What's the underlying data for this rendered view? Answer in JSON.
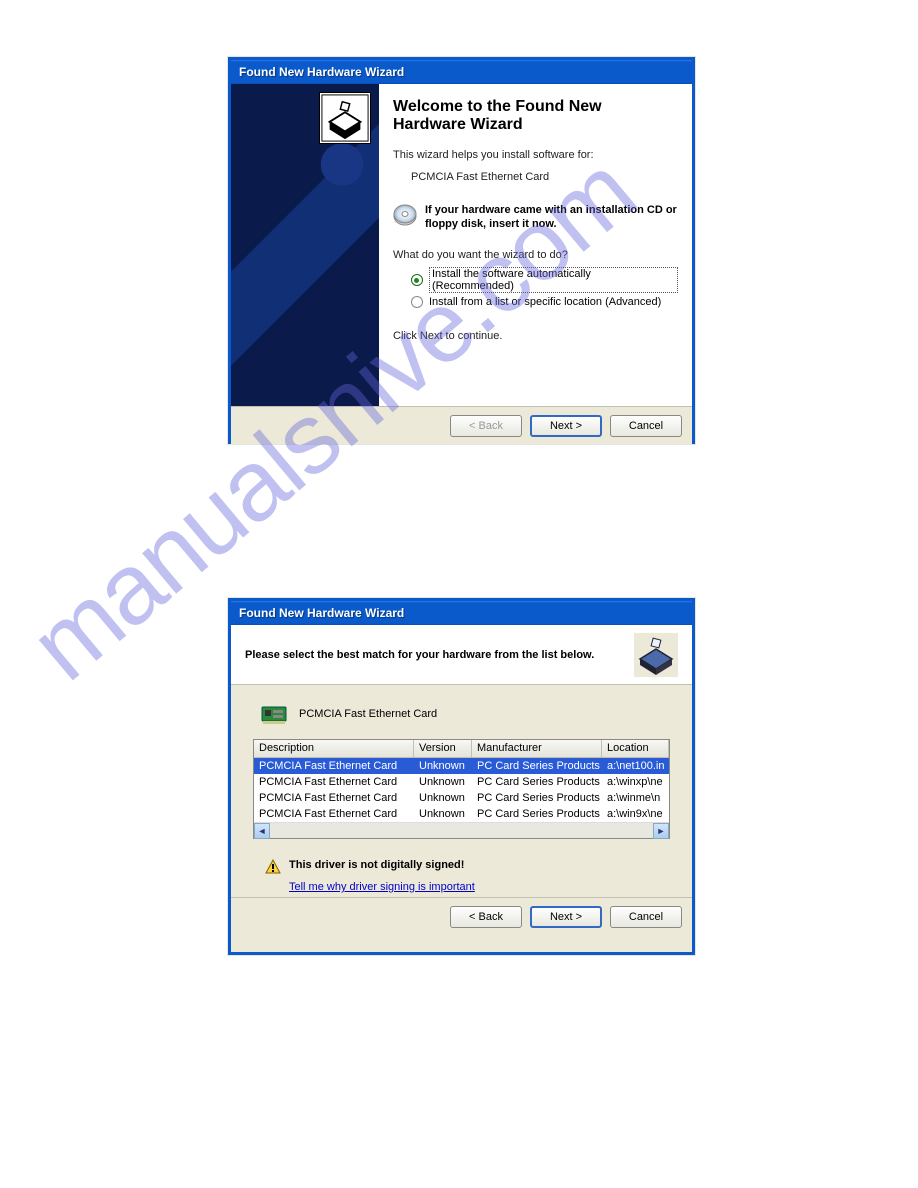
{
  "watermark": "manualsnive.com",
  "dialog1": {
    "title": "Found New Hardware Wizard",
    "heading": "Welcome to the Found New Hardware Wizard",
    "intro": "This wizard helps you install software for:",
    "device": "PCMCIA Fast Ethernet Card",
    "cd_prompt": "If your hardware came with an installation CD or floppy disk, insert it now.",
    "question": "What do you want the wizard to do?",
    "radio_auto": "Install the software automatically (Recommended)",
    "radio_list": "Install from a list or specific location (Advanced)",
    "continue": "Click Next to continue.",
    "buttons": {
      "back": "< Back",
      "next": "Next >",
      "cancel": "Cancel"
    }
  },
  "dialog2": {
    "title": "Found New Hardware Wizard",
    "header": "Please select the best match for your hardware from the list below.",
    "device": "PCMCIA Fast Ethernet Card",
    "columns": {
      "desc": "Description",
      "ver": "Version",
      "man": "Manufacturer",
      "loc": "Location"
    },
    "rows": [
      {
        "desc": "PCMCIA Fast Ethernet Card",
        "ver": "Unknown",
        "man": "PC Card Series Products",
        "loc": "a:\\net100.in"
      },
      {
        "desc": "PCMCIA Fast Ethernet Card",
        "ver": "Unknown",
        "man": "PC Card Series Products",
        "loc": "a:\\winxp\\ne"
      },
      {
        "desc": "PCMCIA Fast Ethernet Card",
        "ver": "Unknown",
        "man": "PC Card Series Products",
        "loc": "a:\\winme\\n"
      },
      {
        "desc": "PCMCIA Fast Ethernet Card",
        "ver": "Unknown",
        "man": "PC Card Series Products",
        "loc": "a:\\win9x\\ne"
      }
    ],
    "warning": "This driver is not digitally signed!",
    "warn_link": "Tell me why driver signing is important",
    "buttons": {
      "back": "< Back",
      "next": "Next >",
      "cancel": "Cancel"
    }
  }
}
